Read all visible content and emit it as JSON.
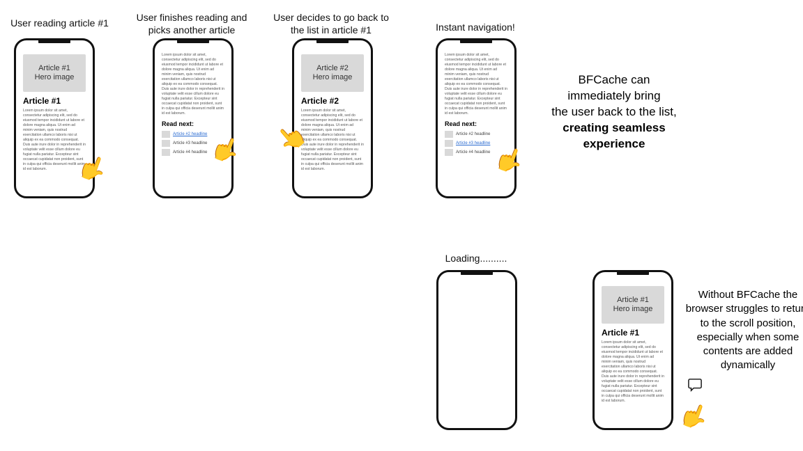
{
  "captions": {
    "c1": "User reading article #1",
    "c2": "User finishes reading and picks another article",
    "c3": "User decides to go back to the list in article #1",
    "c4": "Instant navigation!",
    "c5": "Loading..........",
    "big_line1": "BFCache can",
    "big_line2": "immediately bring",
    "big_line3": "the user back to the list,",
    "big_bold1": "creating seamless",
    "big_bold2": "experience",
    "side_line1": "Without BFCache the",
    "side_line2": "browser struggles to return",
    "side_line3": "to the scroll position,",
    "side_line4": "especially when some",
    "side_line5": "contents are added",
    "side_line6": "dynamically"
  },
  "content": {
    "hero1": "Article #1\nHero image",
    "hero2": "Article #2\nHero image",
    "title1": "Article #1",
    "title2": "Article #2",
    "lorem_long": "Lorem ipsum dolor sit amet, consectetur adipiscing elit, sed do eiusmod tempor incididunt ut labore et dolore magna aliqua. Ut enim ad minim veniam, quis nostrud exercitation ullamco laboris nisi ut aliquip ex ea commodo consequat. Duis aute irure dolor in reprehenderit in voluptate velit esse cillum dolore eu fugiat nulla pariatur. Excepteur sint occaecat cupidatat non proident, sunt in culpa qui officia deserunt mollit anim id est laborum.",
    "lorem_short": "Lorem ipsum dolor sit amet, consectetur adipiscing elit, sed do eiusmod tempor incididunt ut labore et dolore magna aliqua. Ut enim ad minim veniam, quis nostrud exercitation ullamco laboris nisi ut aliquip ex ea commodo consequat. Duis aute irure dolor in reprehenderit in voluptate velit esse cillum dolore eu fugiat nulla pariatur. Excepteur sint occaecat cupidatat non proident, sunt in culpa qui officia deserunt mollit anim id est laborum.",
    "readnext": "Read next:",
    "rn2": "Article #2 headline",
    "rn3": "Article #3 headline",
    "rn4": "Article #4 headline"
  }
}
